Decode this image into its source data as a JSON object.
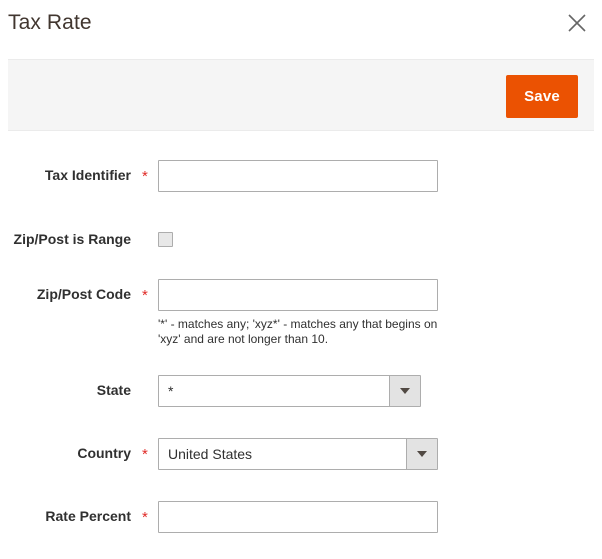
{
  "modal": {
    "title": "Tax Rate",
    "close_icon": "close-icon"
  },
  "toolbar": {
    "save_label": "Save",
    "save_color": "#eb5202"
  },
  "form": {
    "required_marker": "*",
    "fields": [
      {
        "label": "Tax Identifier",
        "type": "text",
        "required": true,
        "value": "",
        "placeholder": ""
      },
      {
        "label": "Zip/Post is Range",
        "type": "checkbox",
        "required": false,
        "checked": false
      },
      {
        "label": "Zip/Post Code",
        "type": "text",
        "required": true,
        "value": "",
        "placeholder": "",
        "note": "'*' - matches any; 'xyz*' - matches any that begins on 'xyz' and are not longer than 10."
      },
      {
        "label": "State",
        "type": "select",
        "required": false,
        "value": "*"
      },
      {
        "label": "Country",
        "type": "select",
        "required": true,
        "value": "United States"
      },
      {
        "label": "Rate Percent",
        "type": "text",
        "required": true,
        "value": "",
        "placeholder": ""
      }
    ]
  },
  "colors": {
    "accent_orange": "#eb5202",
    "required_red": "#e02b27",
    "toolbar_bg": "#f5f5f5",
    "input_border": "#adadad",
    "title_text": "#41362f"
  }
}
